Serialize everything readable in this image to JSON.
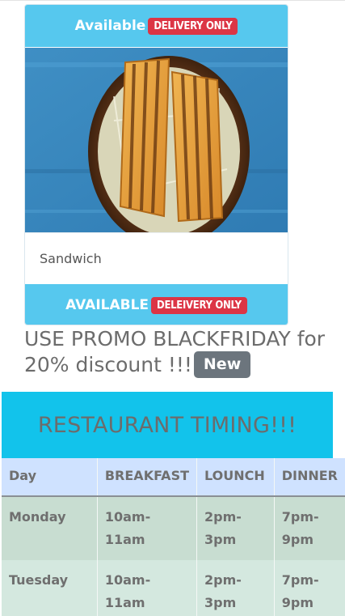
{
  "card": {
    "top_status": "Available",
    "top_badge": "DELIVERY ONLY",
    "item_name": "Sandwich",
    "bottom_status": "AVAILABLE",
    "bottom_badge": "DELEIVERY ONLY",
    "image_icon": "sandwich-photo"
  },
  "promo": {
    "text": "USE PROMO BLACKFRIDAY for 20% discount !!!",
    "badge": "New"
  },
  "timing": {
    "title": "RESTAURANT TIMING!!!",
    "headers": [
      "Day",
      "BREAKFAST",
      "LOUNCH",
      "DINNER"
    ],
    "rows": [
      [
        "Monday",
        "10am-11am",
        "2pm-3pm",
        "7pm-9pm"
      ],
      [
        "Tuesday",
        "10am-11am",
        "2pm-3pm",
        "7pm-9pm"
      ]
    ]
  },
  "colors": {
    "accent": "#56c8ee",
    "banner": "#12c3eb",
    "badge_red": "#dc3545",
    "badge_gray": "#6c757d",
    "table_header": "#cfe2ff",
    "row_bg": "#c8ddd1"
  }
}
